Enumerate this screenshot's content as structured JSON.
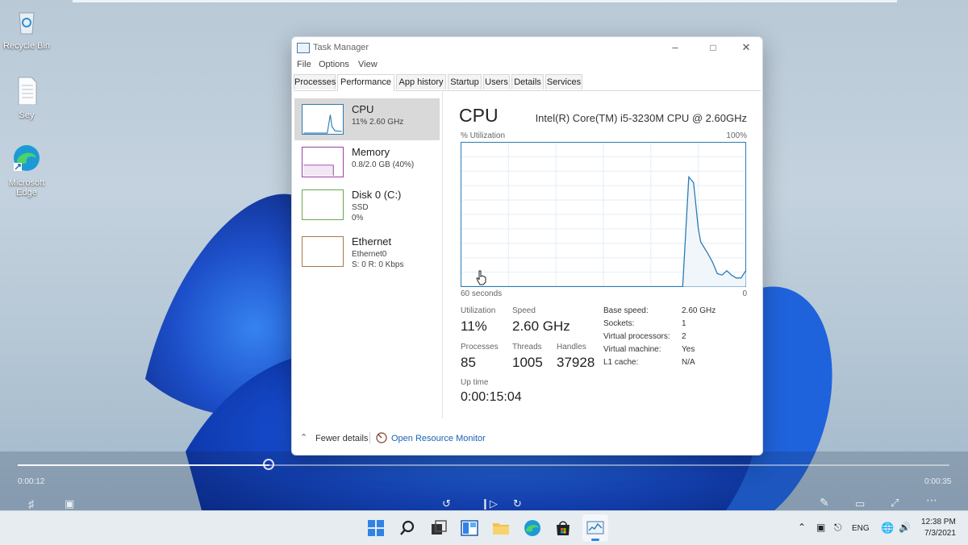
{
  "desktop": {
    "icons": [
      {
        "label": "Recycle Bin",
        "icon": "recycle-bin-icon"
      },
      {
        "label": "Sey",
        "icon": "text-document-icon"
      },
      {
        "label": "Microsoft Edge",
        "icon": "edge-icon"
      }
    ]
  },
  "window": {
    "title": "Task Manager",
    "menu": [
      "File",
      "Options",
      "View"
    ],
    "tabs": [
      "Processes",
      "Performance",
      "App history",
      "Startup",
      "Users",
      "Details",
      "Services"
    ],
    "active_tab": "Performance"
  },
  "sidebar": {
    "items": [
      {
        "name": "CPU",
        "sub1": "11% 2.60 GHz",
        "sub2": "",
        "color": "#2a7bb6"
      },
      {
        "name": "Memory",
        "sub1": "0.8/2.0 GB (40%)",
        "sub2": "",
        "color": "#9a3fa8"
      },
      {
        "name": "Disk 0 (C:)",
        "sub1": "SSD",
        "sub2": "0%",
        "color": "#6aa84f"
      },
      {
        "name": "Ethernet",
        "sub1": "Ethernet0",
        "sub2": "S: 0 R: 0 Kbps",
        "color": "#a6784a"
      }
    ]
  },
  "cpu": {
    "heading": "CPU",
    "model": "Intel(R) Core(TM) i5-3230M CPU @ 2.60GHz",
    "util_label": "% Utilization",
    "max_label": "100%",
    "time_left": "60 seconds",
    "time_right": "0",
    "stats": {
      "utilization_label": "Utilization",
      "utilization": "11%",
      "speed_label": "Speed",
      "speed": "2.60 GHz",
      "processes_label": "Processes",
      "processes": "85",
      "threads_label": "Threads",
      "threads": "1005",
      "handles_label": "Handles",
      "handles": "37928",
      "uptime_label": "Up time",
      "uptime": "0:00:15:04"
    },
    "details": [
      {
        "k": "Base speed:",
        "v": "2.60 GHz"
      },
      {
        "k": "Sockets:",
        "v": "1"
      },
      {
        "k": "Virtual processors:",
        "v": "2"
      },
      {
        "k": "Virtual machine:",
        "v": "Yes"
      },
      {
        "k": "L1 cache:",
        "v": "N/A"
      }
    ]
  },
  "chart_data": {
    "type": "area",
    "x": [
      -60,
      -56,
      -52,
      -48,
      -44,
      -40,
      -36,
      -32,
      -28,
      -24,
      -20,
      -16,
      -15,
      -14,
      -13.3,
      -12,
      -11,
      -10,
      -9.5,
      -8,
      -7,
      -6,
      -5,
      -4,
      -3,
      -2,
      -1,
      0
    ],
    "values": [
      0,
      0,
      0,
      0,
      0,
      0,
      0,
      0,
      0,
      0,
      0,
      0,
      0,
      0,
      0,
      76,
      72,
      40,
      31,
      23,
      17,
      9,
      8,
      11,
      8,
      6,
      6,
      11
    ],
    "ylim": [
      0,
      100
    ],
    "xlim": [
      -60,
      0
    ],
    "grid": true,
    "color": "#2a7bb6"
  },
  "footer": {
    "fewer_details": "Fewer details",
    "open_monitor": "Open Resource Monitor"
  },
  "player": {
    "time_left": "0:00:12",
    "time_right": "0:00:35"
  },
  "tray": {
    "lang": "ENG",
    "time": "12:38 PM",
    "date": "7/3/2021"
  }
}
